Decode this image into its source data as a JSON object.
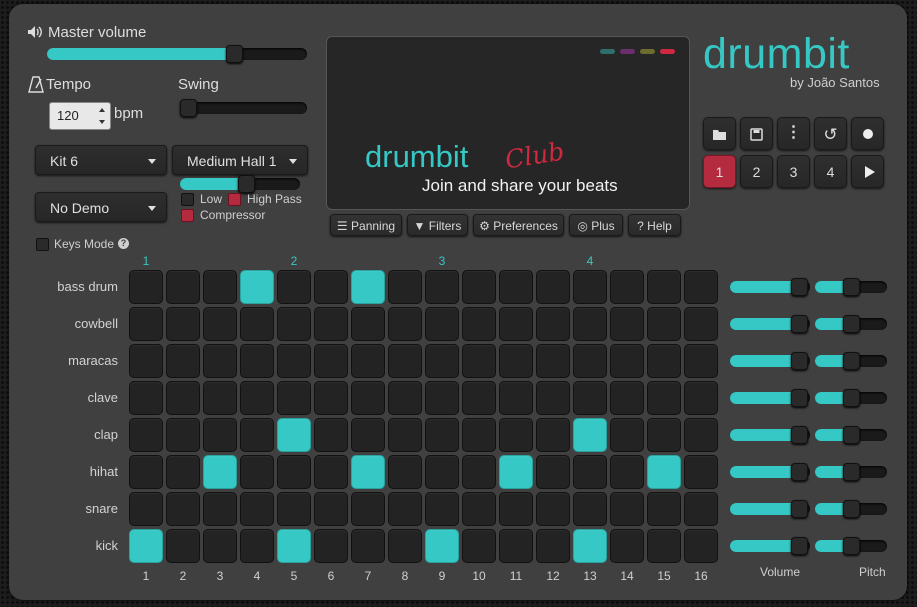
{
  "master": {
    "label": "Master volume",
    "value": 0.72
  },
  "tempo": {
    "label": "Tempo",
    "value": "120",
    "unit": "bpm"
  },
  "swing": {
    "label": "Swing",
    "value": 0.0
  },
  "kit": {
    "selected": "Kit 6"
  },
  "reverb": {
    "selected": "Medium Hall 1",
    "level": 0.55
  },
  "demo": {
    "selected": "No Demo"
  },
  "filters": {
    "low": "Low",
    "high_pass": "High Pass",
    "compressor": "Compressor"
  },
  "keys_mode": {
    "label": "Keys Mode",
    "help": "?"
  },
  "promo": {
    "title": "drumbit",
    "club": "Club",
    "tagline": "Join and share your beats",
    "dot_colors": [
      "#2f6e6c",
      "#6c2f6e",
      "#6c6c2f",
      "#d0293f"
    ]
  },
  "brand": {
    "title": "drumbit",
    "author": "by João Santos",
    "color": "#36c8c4"
  },
  "toolbar": {
    "panning": "Panning",
    "filters": "Filters",
    "preferences": "Preferences",
    "plus": "Plus",
    "help": "Help"
  },
  "patterns": [
    "1",
    "2",
    "3",
    "4"
  ],
  "active_pattern": 0,
  "beats": [
    "1",
    "2",
    "3",
    "4"
  ],
  "steps": [
    "1",
    "2",
    "3",
    "4",
    "5",
    "6",
    "7",
    "8",
    "9",
    "10",
    "11",
    "12",
    "13",
    "14",
    "15",
    "16"
  ],
  "tracks": [
    {
      "name": "bass drum",
      "steps": [
        0,
        0,
        0,
        1,
        0,
        0,
        1,
        0,
        0,
        0,
        0,
        0,
        0,
        0,
        0,
        0
      ],
      "volume": 0.86,
      "pitch": 0.5
    },
    {
      "name": "cowbell",
      "steps": [
        0,
        0,
        0,
        0,
        0,
        0,
        0,
        0,
        0,
        0,
        0,
        0,
        0,
        0,
        0,
        0
      ],
      "volume": 0.86,
      "pitch": 0.5
    },
    {
      "name": "maracas",
      "steps": [
        0,
        0,
        0,
        0,
        0,
        0,
        0,
        0,
        0,
        0,
        0,
        0,
        0,
        0,
        0,
        0
      ],
      "volume": 0.86,
      "pitch": 0.5
    },
    {
      "name": "clave",
      "steps": [
        0,
        0,
        0,
        0,
        0,
        0,
        0,
        0,
        0,
        0,
        0,
        0,
        0,
        0,
        0,
        0
      ],
      "volume": 0.86,
      "pitch": 0.5
    },
    {
      "name": "clap",
      "steps": [
        0,
        0,
        0,
        0,
        1,
        0,
        0,
        0,
        0,
        0,
        0,
        0,
        1,
        0,
        0,
        0
      ],
      "volume": 0.86,
      "pitch": 0.5
    },
    {
      "name": "hihat",
      "steps": [
        0,
        0,
        1,
        0,
        0,
        0,
        1,
        0,
        0,
        0,
        1,
        0,
        0,
        0,
        1,
        0
      ],
      "volume": 0.86,
      "pitch": 0.5
    },
    {
      "name": "snare",
      "steps": [
        0,
        0,
        0,
        0,
        0,
        0,
        0,
        0,
        0,
        0,
        0,
        0,
        0,
        0,
        0,
        0
      ],
      "volume": 0.86,
      "pitch": 0.5
    },
    {
      "name": "kick",
      "steps": [
        1,
        0,
        0,
        0,
        1,
        0,
        0,
        0,
        1,
        0,
        0,
        0,
        1,
        0,
        0,
        0
      ],
      "volume": 0.86,
      "pitch": 0.5
    }
  ],
  "footer": {
    "volume": "Volume",
    "pitch": "Pitch"
  }
}
